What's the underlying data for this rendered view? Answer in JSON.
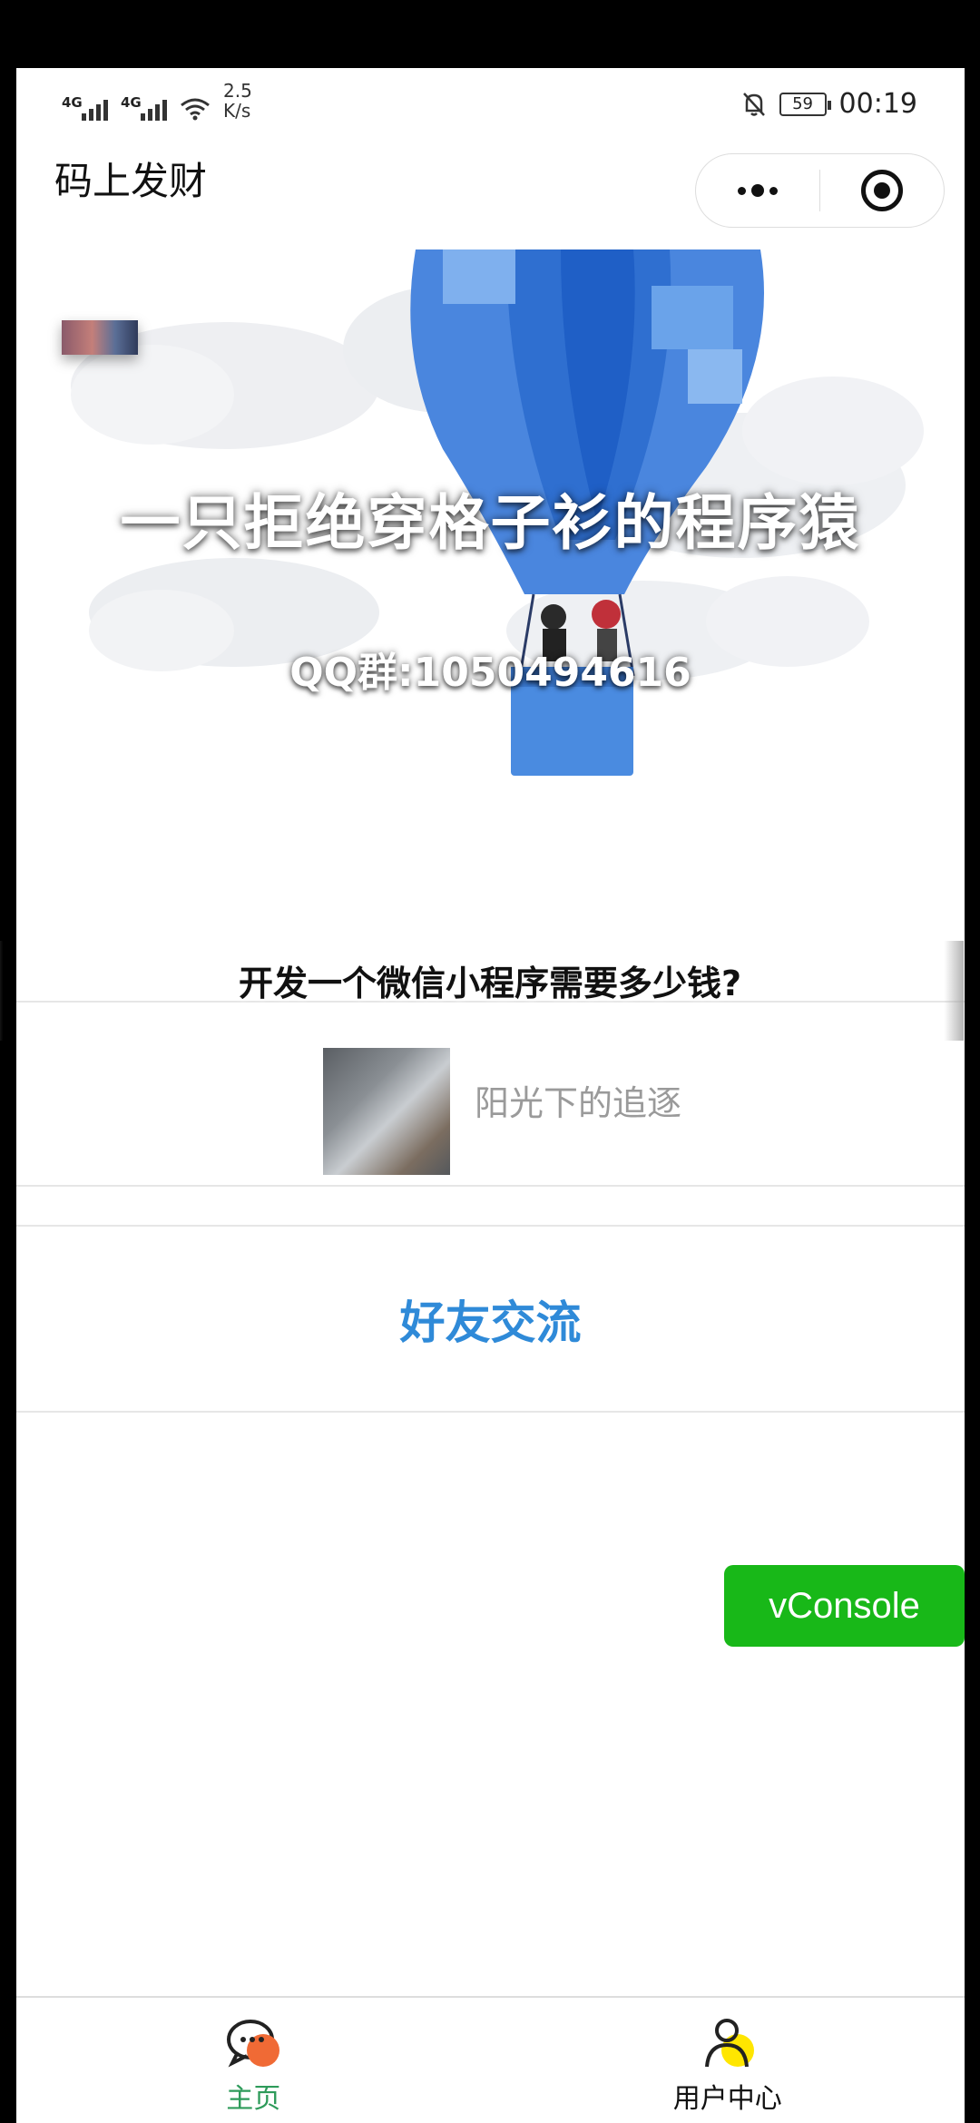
{
  "status_bar": {
    "signal1": "4G",
    "signal2": "4G",
    "speed_value": "2.5",
    "speed_unit": "K/s",
    "battery": "59",
    "time": "00:19"
  },
  "nav": {
    "title": "码上发财"
  },
  "banner": {
    "title": "一只拒绝穿格子衫的程序猿",
    "qq": "QQ群:1050494616"
  },
  "article": {
    "overlay_title": "开发一个微信小程序需要多少钱?",
    "subtitle": "阳光下的追逐"
  },
  "friends": {
    "label": "好友交流"
  },
  "vconsole": {
    "label": "vConsole"
  },
  "tabbar": {
    "home": "主页",
    "user": "用户中心"
  },
  "colors": {
    "accent_green": "#2e9b5a",
    "link_blue": "#2f8ad8",
    "vconsole_green": "#18b818"
  }
}
